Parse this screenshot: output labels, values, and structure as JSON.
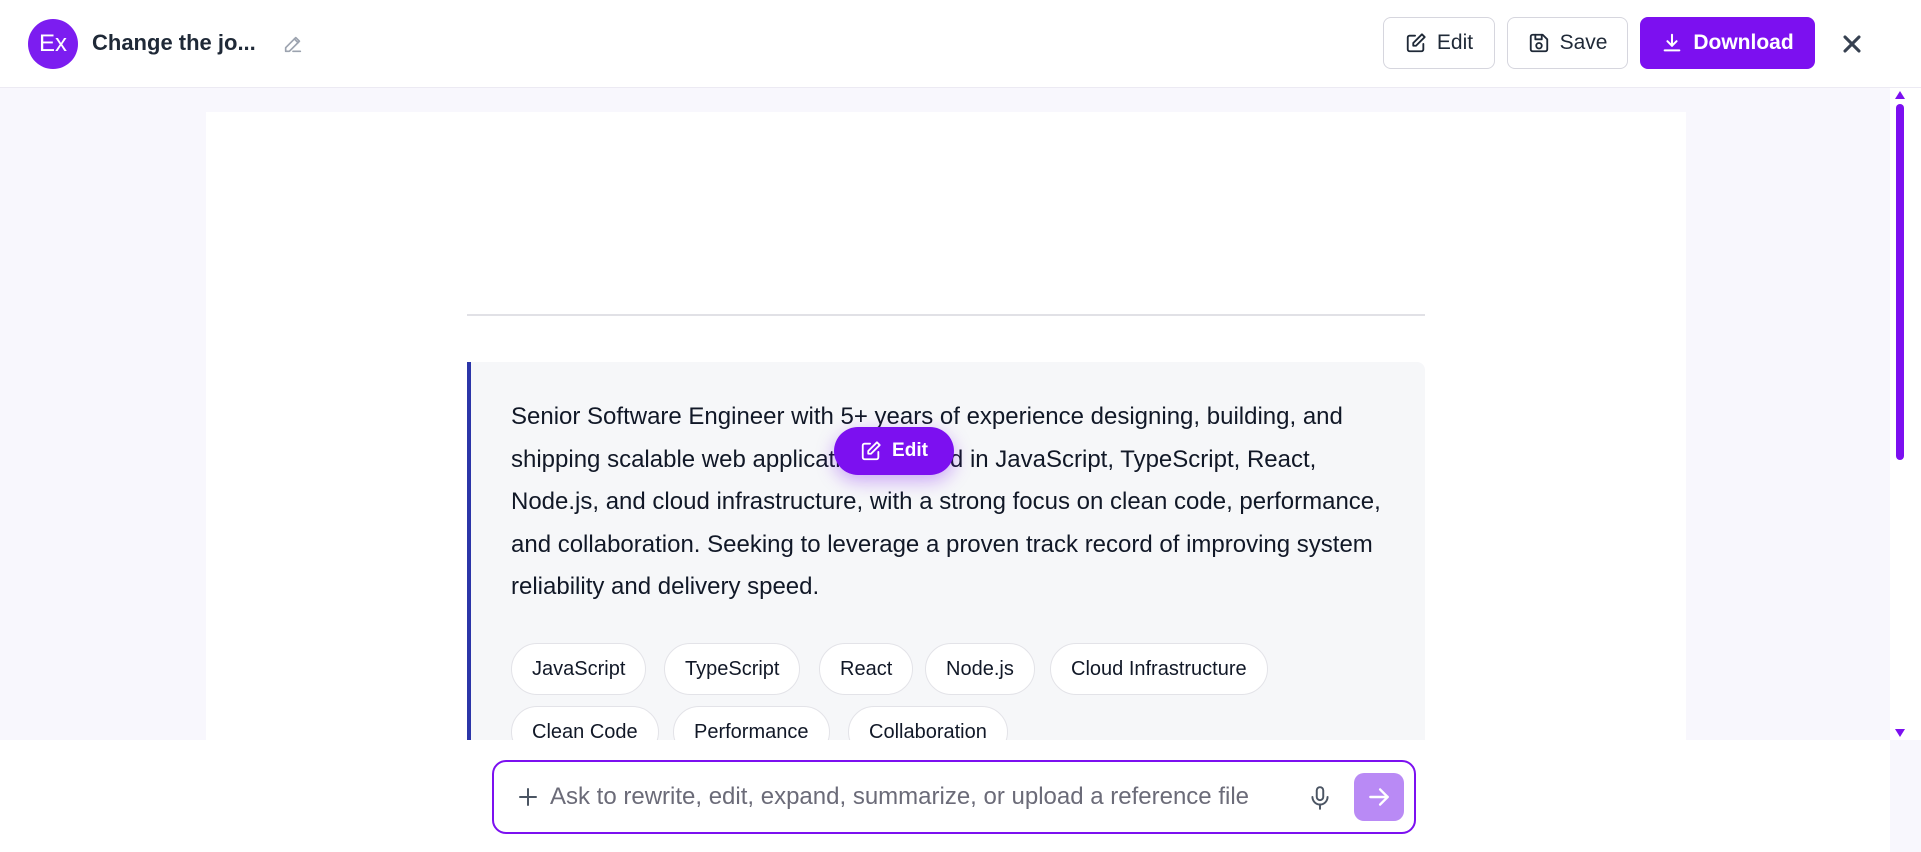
{
  "header": {
    "avatar_text": "Ex",
    "doc_title": "Change the jo...",
    "edit_label": "Edit",
    "save_label": "Save",
    "download_label": "Download"
  },
  "document": {
    "summary": "Senior Software Engineer with 5+ years of experience designing, building, and shipping scalable web applications. Skilled in JavaScript, TypeScript, React, Node.js, and cloud infrastructure, with a strong focus on clean code, performance, and collaboration. Seeking to leverage a proven track record of improving system reliability and delivery speed.",
    "tags": [
      "JavaScript",
      "TypeScript",
      "React",
      "Node.js",
      "Cloud Infrastructure",
      "Clean Code",
      "Performance",
      "Collaboration"
    ],
    "floating_edit_label": "Edit"
  },
  "chat": {
    "placeholder": "Ask to rewrite, edit, expand, summarize, or upload a reference file",
    "value": ""
  },
  "colors": {
    "accent": "#7c10f0",
    "accent_light": "#b98af5",
    "card_border": "#2b35a8"
  },
  "icons": {
    "rename": "pencil-icon",
    "edit": "edit-square-icon",
    "save": "floppy-disk-icon",
    "download": "download-icon",
    "close": "close-icon",
    "add": "plus-icon",
    "mic": "microphone-icon",
    "send": "arrow-right-icon"
  }
}
